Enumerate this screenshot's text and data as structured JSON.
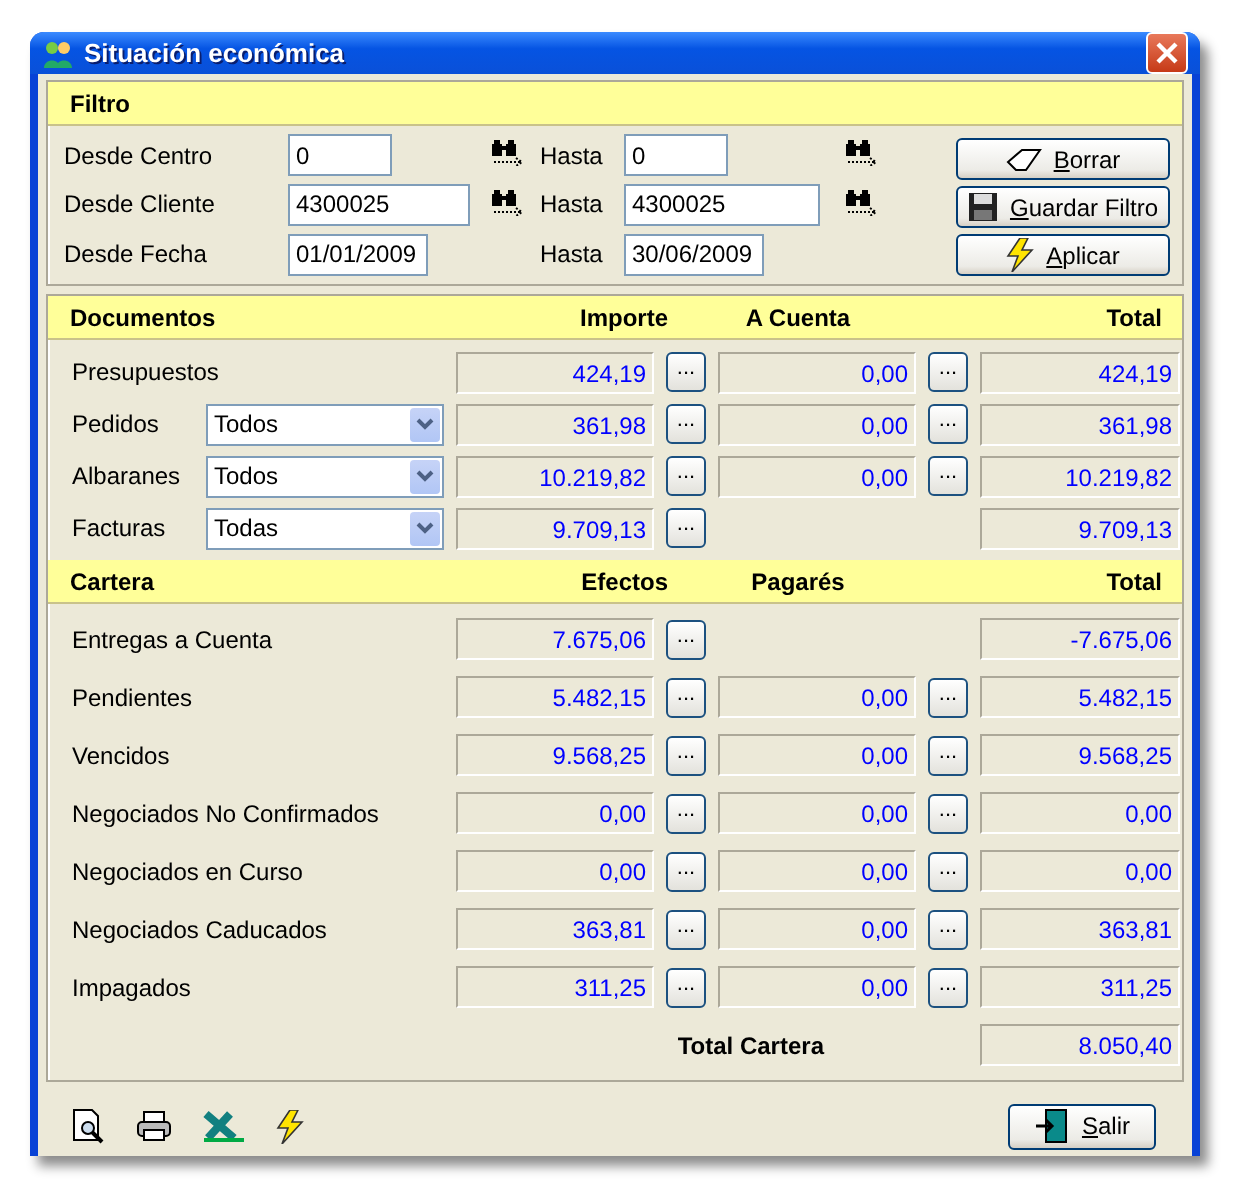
{
  "window": {
    "title": "Situación económica"
  },
  "filter": {
    "title": "Filtro",
    "rows": [
      {
        "label": "Desde Centro",
        "from": "0",
        "lookup": true,
        "to_label": "Hasta",
        "to": "0",
        "to_lookup": true
      },
      {
        "label": "Desde Cliente",
        "from": "4300025",
        "lookup": true,
        "to_label": "Hasta",
        "to": "4300025",
        "to_lookup": true
      },
      {
        "label": "Desde Fecha",
        "from": "01/01/2009",
        "lookup": false,
        "to_label": "Hasta",
        "to": "30/06/2009",
        "to_lookup": false
      }
    ],
    "buttons": [
      {
        "label": "Borrar",
        "kind": "eraser"
      },
      {
        "label": "Guardar Filtro",
        "kind": "save"
      },
      {
        "label": "Aplicar",
        "kind": "bolt"
      }
    ]
  },
  "documents": {
    "columns": [
      "Documentos",
      "Importe",
      "A Cuenta",
      "Total"
    ],
    "rows": [
      {
        "label": "Presupuestos",
        "importe": "424,19",
        "a_cuenta": "0,00",
        "total": "424,19"
      },
      {
        "label": "Pedidos",
        "select": "Todos",
        "importe": "361,98",
        "a_cuenta": "0,00",
        "total": "361,98"
      },
      {
        "label": "Albaranes",
        "select": "Todos",
        "importe": "10.219,82",
        "a_cuenta": "0,00",
        "total": "10.219,82"
      },
      {
        "label": "Facturas",
        "select": "Todas",
        "importe": "9.709,13",
        "total": "9.709,13"
      }
    ]
  },
  "cartera": {
    "columns": [
      "Cartera",
      "Efectos",
      "Pagarés",
      "Total"
    ],
    "rows": [
      {
        "label": "Entregas a Cuenta",
        "efectos": "7.675,06",
        "total": "-7.675,06"
      },
      {
        "label": "Pendientes",
        "efectos": "5.482,15",
        "pagares": "0,00",
        "total": "5.482,15"
      },
      {
        "label": "Vencidos",
        "efectos": "9.568,25",
        "pagares": "0,00",
        "total": "9.568,25"
      },
      {
        "label": "Negociados No Confirmados",
        "efectos": "0,00",
        "pagares": "0,00",
        "total": "0,00"
      },
      {
        "label": "Negociados en Curso",
        "efectos": "0,00",
        "pagares": "0,00",
        "total": "0,00"
      },
      {
        "label": "Negociados Caducados",
        "efectos": "363,81",
        "pagares": "0,00",
        "total": "363,81"
      },
      {
        "label": "Impagados",
        "efectos": "311,25",
        "pagares": "0,00",
        "total": "311,25"
      }
    ],
    "total_label": "Total Cartera",
    "total": "8.050,40"
  },
  "toolbar": [
    {
      "kind": "preview"
    },
    {
      "kind": "print"
    },
    {
      "kind": "excel"
    },
    {
      "kind": "bolt"
    }
  ],
  "more_label": "...",
  "exit_button": {
    "label": "Salir"
  }
}
